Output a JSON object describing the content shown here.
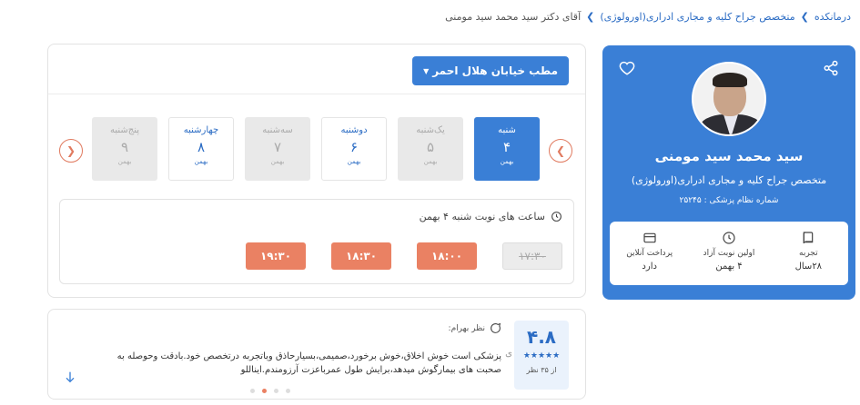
{
  "breadcrumb": {
    "home": "درمانکده",
    "category": "متخصص جراح کلیه و مجاری ادراری(اورولوژی)",
    "current": "آقای دکتر سید محمد سید مومنی"
  },
  "doctor": {
    "name": "سید محمد سید مومنی",
    "specialty": "متخصص جراح کلیه و مجاری ادراری(اورولوژی)",
    "medical_code": "شماره نظام پزشکی : ۲۵۲۴۵",
    "stats": [
      {
        "icon": "book-icon",
        "label": "تجربه",
        "value": "۲۸سال"
      },
      {
        "icon": "clock-icon",
        "label": "اولین نوبت آزاد",
        "value": "۴ بهمن"
      },
      {
        "icon": "card-icon",
        "label": "پرداخت آنلاین",
        "value": "دارد"
      }
    ]
  },
  "appointment": {
    "office": "مطب خیابان هلال احمر",
    "days": [
      {
        "name": "شنبه",
        "num": "۴",
        "month": "بهمن",
        "state": "selected"
      },
      {
        "name": "یک‌شنبه",
        "num": "۵",
        "month": "بهمن",
        "state": "disabled"
      },
      {
        "name": "دوشنبه",
        "num": "۶",
        "month": "بهمن",
        "state": "normal"
      },
      {
        "name": "سه‌شنبه",
        "num": "۷",
        "month": "بهمن",
        "state": "disabled"
      },
      {
        "name": "چهارشنبه",
        "num": "۸",
        "month": "بهمن",
        "state": "normal"
      },
      {
        "name": "پنج‌شنبه",
        "num": "۹",
        "month": "بهمن",
        "state": "disabled"
      }
    ],
    "slots_title": "ساعت های نوبت شنبه ۴ بهمن",
    "slots": [
      {
        "time": "۱۷:۳۰",
        "state": "disabled"
      },
      {
        "time": "۱۸:۰۰",
        "state": "available"
      },
      {
        "time": "۱۸:۳۰",
        "state": "available"
      },
      {
        "time": "۱۹:۳۰",
        "state": "available"
      }
    ]
  },
  "review": {
    "score": "۴.۸",
    "stars": "★★★★★",
    "count": "از ۳۵ نظر",
    "author": "نظر بهرام:",
    "text": "پزشکی است خوش اخلاق،خوش برخورد،صمیمی،بسیارحاذق وباتجربه درتخصص خود.بادقت وحوصله به صحبت های بیمارگوش میدهد،برایش طول عمرباعزت آرزومندم.ایناللو",
    "next_glyph": "ی"
  },
  "colors": {
    "primary": "#3a7fd6",
    "accent": "#ea8163"
  }
}
